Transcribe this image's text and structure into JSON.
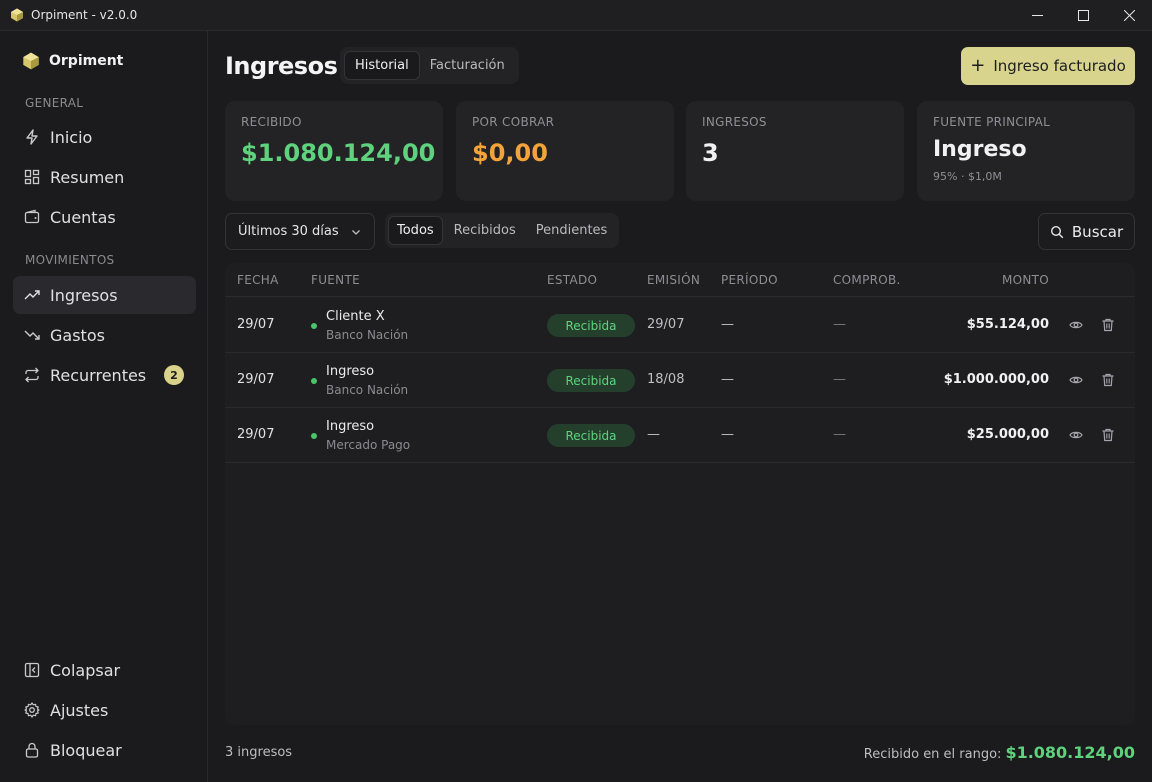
{
  "window": {
    "title": "Orpiment - v2.0.0"
  },
  "sidebar": {
    "brand": "Orpiment",
    "sections": [
      {
        "label": "GENERAL",
        "items": [
          {
            "label": "Inicio",
            "icon": "bolt-icon"
          },
          {
            "label": "Resumen",
            "icon": "grid-icon"
          },
          {
            "label": "Cuentas",
            "icon": "wallet-icon"
          }
        ]
      },
      {
        "label": "MOVIMIENTOS",
        "items": [
          {
            "label": "Ingresos",
            "icon": "trending-up-icon",
            "active": true
          },
          {
            "label": "Gastos",
            "icon": "trending-down-icon"
          },
          {
            "label": "Recurrentes",
            "icon": "repeat-icon",
            "badge": "2"
          }
        ]
      }
    ],
    "bottom": [
      {
        "label": "Colapsar",
        "icon": "collapse-icon"
      },
      {
        "label": "Ajustes",
        "icon": "gear-icon"
      },
      {
        "label": "Bloquear",
        "icon": "lock-icon"
      }
    ]
  },
  "header": {
    "title": "Ingresos",
    "tabs": [
      {
        "label": "Historial",
        "active": true
      },
      {
        "label": "Facturación"
      }
    ],
    "primary_action": "Ingreso facturado"
  },
  "stats": [
    {
      "label": "RECIBIDO",
      "value": "$1.080.124,00",
      "color": "#5fd27d"
    },
    {
      "label": "POR COBRAR",
      "value": "$0,00",
      "color": "#f2a43a"
    },
    {
      "label": "INGRESOS",
      "value": "3",
      "color": "#f1f1f3"
    },
    {
      "label": "FUENTE PRINCIPAL",
      "value": "Ingreso",
      "sub": "95% · $1,0M",
      "color": "#f1f1f3"
    }
  ],
  "filters": {
    "range": "Últimos 30 días",
    "status_tabs": [
      {
        "label": "Todos",
        "active": true
      },
      {
        "label": "Recibidos"
      },
      {
        "label": "Pendientes"
      }
    ],
    "search": "Buscar"
  },
  "table": {
    "columns": [
      "FECHA",
      "FUENTE",
      "ESTADO",
      "EMISIÓN",
      "PERÍODO",
      "COMPROB.",
      "MONTO"
    ],
    "rows": [
      {
        "fecha": "29/07",
        "fuente": "Cliente X",
        "cuenta": "Banco Nación",
        "estado": "Recibida",
        "emision": "29/07",
        "periodo": "—",
        "comprob": "—",
        "monto": "$55.124,00"
      },
      {
        "fecha": "29/07",
        "fuente": "Ingreso",
        "cuenta": "Banco Nación",
        "estado": "Recibida",
        "emision": "18/08",
        "periodo": "—",
        "comprob": "—",
        "monto": "$1.000.000,00"
      },
      {
        "fecha": "29/07",
        "fuente": "Ingreso",
        "cuenta": "Mercado Pago",
        "estado": "Recibida",
        "emision": "—",
        "periodo": "—",
        "comprob": "—",
        "monto": "$25.000,00"
      }
    ]
  },
  "footer": {
    "count": "3 ingresos",
    "range_label": "Recibido en el rango:",
    "range_total": "$1.080.124,00"
  }
}
